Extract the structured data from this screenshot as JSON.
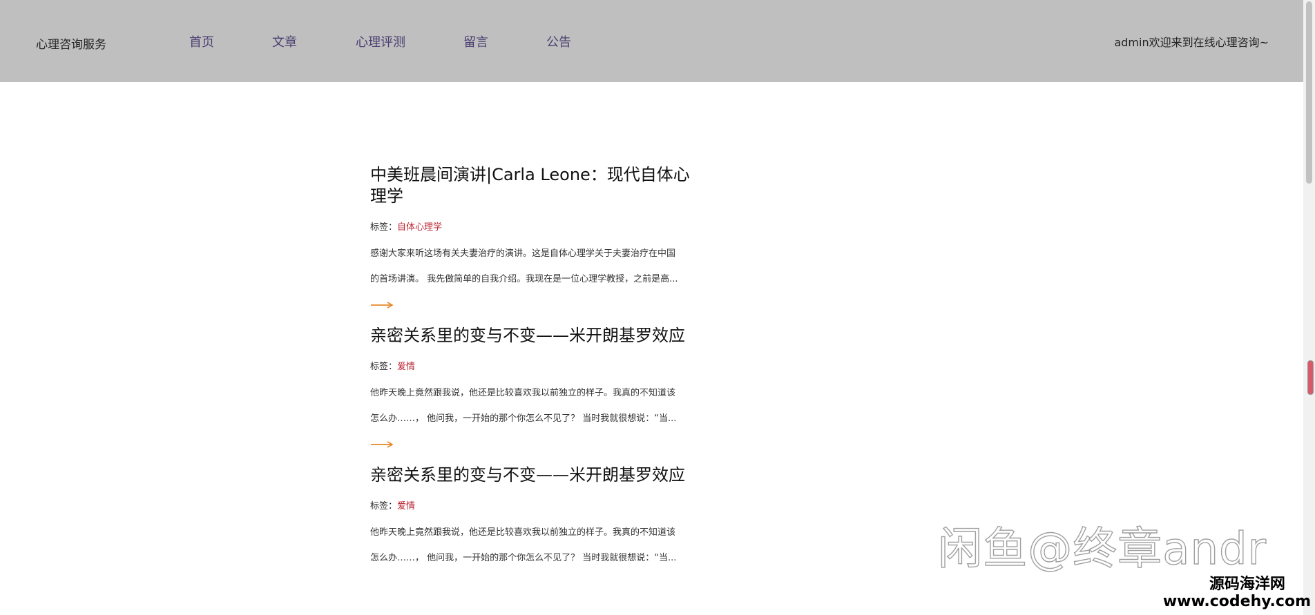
{
  "header": {
    "brand": "心理咨询服务",
    "nav": [
      {
        "label": "首页"
      },
      {
        "label": "文章"
      },
      {
        "label": "心理评测"
      },
      {
        "label": "留言"
      },
      {
        "label": "公告"
      }
    ],
    "welcome": "admin欢迎来到在线心理咨询~"
  },
  "articles": [
    {
      "title": "中美班晨间演讲|Carla Leone：现代自体心理学",
      "tag_label": "标签：",
      "tag": "自体心理学",
      "summary_line1": "感谢大家来听这场有关夫妻治疗的演讲。这是自体心理学关于夫妻治疗在中国",
      "summary_line2": "的首场讲演。 我先做简单的自我介绍。我现在是一位心理学教授，之前是高..."
    },
    {
      "title": "亲密关系里的变与不变——米开朗基罗效应",
      "tag_label": "标签：",
      "tag": "爱情",
      "summary_line1": "他昨天晚上竟然跟我说，他还是比较喜欢我以前独立的样子。我真的不知道该",
      "summary_line2": "怎么办……， 他问我，一开始的那个你怎么不见了？ 当时我就很想说：“当..."
    },
    {
      "title": "亲密关系里的变与不变——米开朗基罗效应",
      "tag_label": "标签：",
      "tag": "爱情",
      "summary_line1": "他昨天晚上竟然跟我说，他还是比较喜欢我以前独立的样子。我真的不知道该",
      "summary_line2": "怎么办……， 他问我，一开始的那个你怎么不见了？ 当时我就很想说：“当..."
    }
  ],
  "watermark": {
    "text": "闲鱼@终章andr",
    "site_name": "源码海洋网",
    "site_url": "www.codehy.com"
  },
  "colors": {
    "header_bg": "#bfbfbf",
    "nav_link": "#4b3f72",
    "tag": "#b8232f",
    "arrow": "#e8862a"
  },
  "icons": {
    "read_more": "arrow-right-icon"
  }
}
